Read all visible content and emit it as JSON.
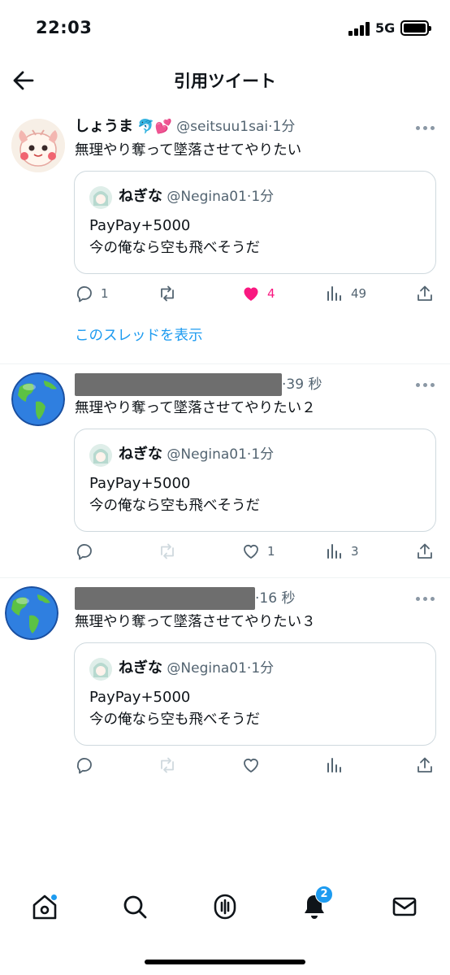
{
  "status_bar": {
    "time": "22:03",
    "network": "5G"
  },
  "header": {
    "title": "引用ツイート"
  },
  "tweets": [
    {
      "name": "しょうま",
      "name_emoji": "🐬💕",
      "handle": "@seitsuu1sai",
      "time": "1分",
      "text": "無理やり奪って墜落させてやりたい",
      "quote": {
        "name": "ねぎな",
        "handle": "@Negina01",
        "time": "1分",
        "line1": "PayPay+5000",
        "line2": "今の俺なら空も飛べそうだ"
      },
      "actions": {
        "replies": "1",
        "retweets": "",
        "likes": "4",
        "views": "49"
      },
      "liked": true,
      "show_thread": "このスレッドを表示"
    },
    {
      "name": "",
      "handle": "",
      "time": "39 秒",
      "text": "無理やり奪って墜落させてやりたい２",
      "quote": {
        "name": "ねぎな",
        "handle": "@Negina01",
        "time": "1分",
        "line1": "PayPay+5000",
        "line2": "今の俺なら空も飛べそうだ"
      },
      "actions": {
        "replies": "",
        "retweets": "",
        "likes": "1",
        "views": "3"
      },
      "liked": false
    },
    {
      "name": "",
      "handle": "",
      "time": "16 秒",
      "text": "無理やり奪って墜落させてやりたい３",
      "quote": {
        "name": "ねぎな",
        "handle": "@Negina01",
        "time": "1分",
        "line1": "PayPay+5000",
        "line2": "今の俺なら空も飛べそうだ"
      },
      "actions": {
        "replies": "",
        "retweets": "",
        "likes": "",
        "views": ""
      },
      "liked": false
    }
  ],
  "bottom_nav": {
    "items": [
      "home-icon",
      "search-icon",
      "spaces-icon",
      "bell-icon",
      "mail-icon"
    ],
    "notification_count": "2"
  },
  "colors": {
    "accent": "#1d9bf0",
    "like": "#f91880",
    "muted": "#536471"
  }
}
